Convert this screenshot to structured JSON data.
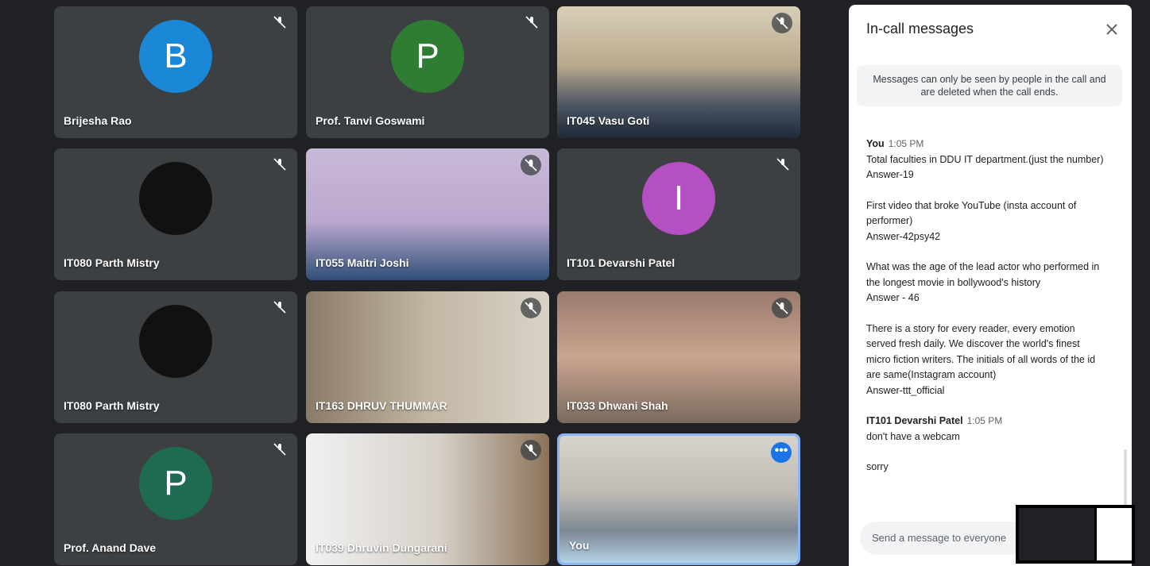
{
  "tiles": [
    {
      "name": "Brijesha Rao",
      "initial": "B",
      "avatar_color": "#1a88d7"
    },
    {
      "name": "Prof. Tanvi Goswami",
      "initial": "P",
      "avatar_color": "#2e7d32"
    },
    {
      "name": "IT045 Vasu Goti"
    },
    {
      "name": "IT080 Parth Mistry"
    },
    {
      "name": "IT055 Maitri Joshi"
    },
    {
      "name": "IT101 Devarshi Patel",
      "initial": "I",
      "avatar_color": "#b44fc4"
    },
    {
      "name": "IT080 Parth Mistry"
    },
    {
      "name": "IT163 DHRUV THUMMAR"
    },
    {
      "name": "IT033 Dhwani Shah"
    },
    {
      "name": "Prof. Anand Dave",
      "initial": "P",
      "avatar_color": "#1e6b4f"
    },
    {
      "name": "IT039 Dhruvin Dungarani"
    },
    {
      "name": "You",
      "more": "•••"
    }
  ],
  "panel": {
    "title": "In-call messages",
    "notice": "Messages can only be seen by people in the call and are deleted when the call ends.",
    "input_placeholder": "Send a message to everyone"
  },
  "messages": [
    {
      "sender": "You",
      "time": "1:05 PM",
      "lines": [
        "Total faculties in DDU IT department.(just the number)",
        "Answer-19",
        "",
        "First video that broke YouTube (insta account of performer)",
        "Answer-42psy42",
        "",
        "What was the age of the lead actor who performed in the longest movie in bollywood's history",
        "Answer - 46",
        "",
        "There is a story for every reader, every emotion served fresh daily. We discover the world's finest micro fiction writers. The initials of all words of the id are same(Instagram account)",
        "Answer-ttt_official"
      ]
    },
    {
      "sender": "IT101 Devarshi Patel",
      "time": "1:05 PM",
      "lines": [
        "don't have a webcam",
        "",
        "sorry"
      ]
    }
  ],
  "icons": {
    "mic": "mic-off-icon",
    "close": "close-icon",
    "more": "more-options-icon"
  }
}
